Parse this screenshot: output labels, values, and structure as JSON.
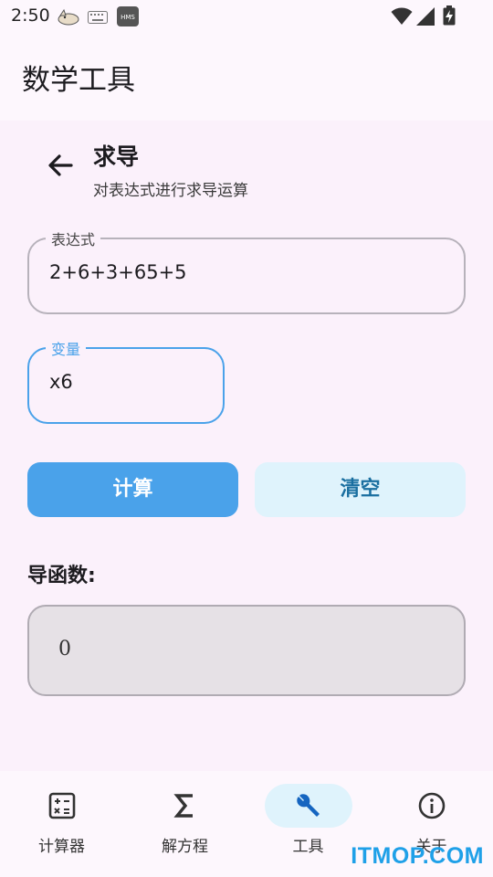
{
  "status_bar": {
    "time": "2:50",
    "hms_badge": "HMS",
    "icons": [
      "cat-icon",
      "keyboard-icon",
      "hms-icon",
      "wifi-icon",
      "signal-icon",
      "battery-icon"
    ]
  },
  "app_bar": {
    "title": "数学工具"
  },
  "page": {
    "title": "求导",
    "subtitle": "对表达式进行求导运算"
  },
  "form": {
    "expression": {
      "label": "表达式",
      "value": "2+6+3+65+5"
    },
    "variable": {
      "label": "变量",
      "value": "x6"
    }
  },
  "buttons": {
    "calculate": "计算",
    "clear": "清空"
  },
  "result": {
    "label": "导函数:",
    "value": "0"
  },
  "bottom_nav": {
    "items": [
      {
        "label": "计算器",
        "icon": "calculator-icon",
        "active": false
      },
      {
        "label": "解方程",
        "icon": "sigma-icon",
        "active": false
      },
      {
        "label": "工具",
        "icon": "wrench-icon",
        "active": true
      },
      {
        "label": "关于",
        "icon": "info-icon",
        "active": false
      }
    ]
  },
  "watermark": "ITMOP.COM",
  "colors": {
    "accent": "#4aa2ea",
    "accent_light": "#dff3fc",
    "background": "#fbf1fb"
  }
}
